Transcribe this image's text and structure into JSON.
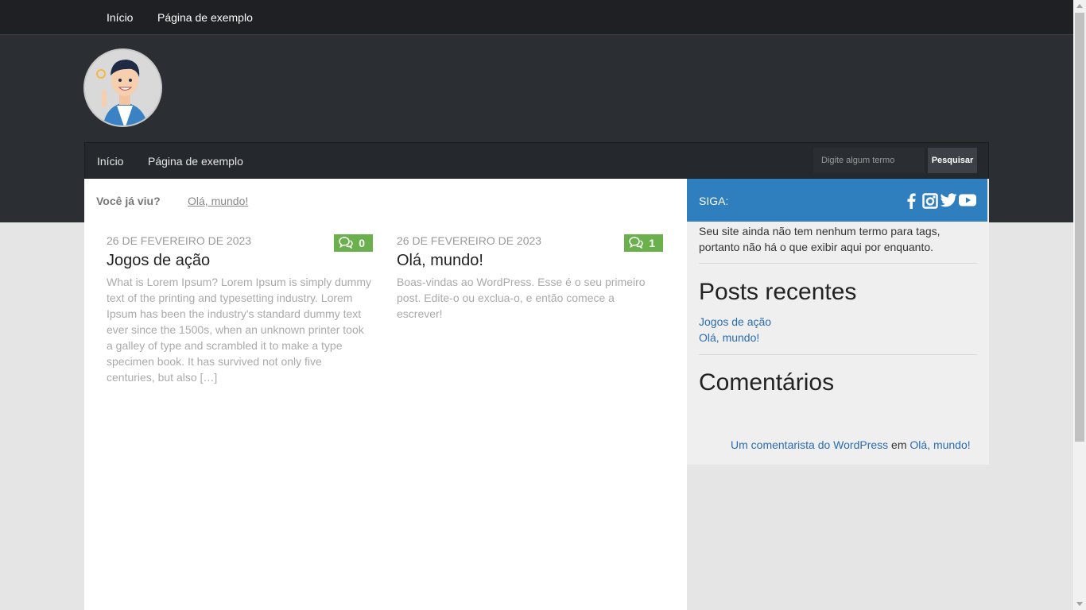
{
  "topbar": {
    "items": [
      {
        "label": "Início"
      },
      {
        "label": "Página de exemplo"
      }
    ]
  },
  "nav": {
    "items": [
      {
        "label": "Início"
      },
      {
        "label": "Página de exemplo"
      }
    ],
    "search_placeholder": "Digite algum termo",
    "search_button": "Pesquisar"
  },
  "seen": {
    "label": "Você já viu?",
    "link": "Olá, mundo!"
  },
  "posts": [
    {
      "date": "26 de fevereiro de 2023",
      "title": "Jogos de ação",
      "comments": "0",
      "excerpt": "What is Lorem Ipsum? Lorem Ipsum is simply dummy text of the printing and typesetting industry. Lorem Ipsum has been the industry's standard dummy text ever since the 1500s, when an unknown printer took a galley of type and scrambled it to make a type specimen book. It has survived not only five centuries, but also […]"
    },
    {
      "date": "26 de fevereiro de 2023",
      "title": "Olá, mundo!",
      "comments": "1",
      "excerpt": "Boas-vindas ao WordPress. Esse é o seu primeiro post. Edite-o ou exclua-o, e então comece a escrever!"
    }
  ],
  "sidebar": {
    "siga_label": "SIGA:",
    "social_icons": [
      "facebook-icon",
      "instagram-icon",
      "twitter-icon",
      "youtube-icon"
    ],
    "tags_text": "Seu site ainda não tem nenhum termo para tags, portanto não há o que exibir aqui por enquanto.",
    "recent_title": "Posts recentes",
    "recent_posts": [
      {
        "label": "Jogos de ação"
      },
      {
        "label": "Olá, mundo!"
      }
    ],
    "comments_title": "Comentários",
    "comment": {
      "author": "Um comentarista do WordPress",
      "connector": "em",
      "post": "Olá, mundo!"
    }
  },
  "colors": {
    "dark_header": "#2b2e33",
    "accent_blue": "#2f7fbe",
    "comment_green": "#6ab04c",
    "link_blue": "#2b6db0"
  }
}
